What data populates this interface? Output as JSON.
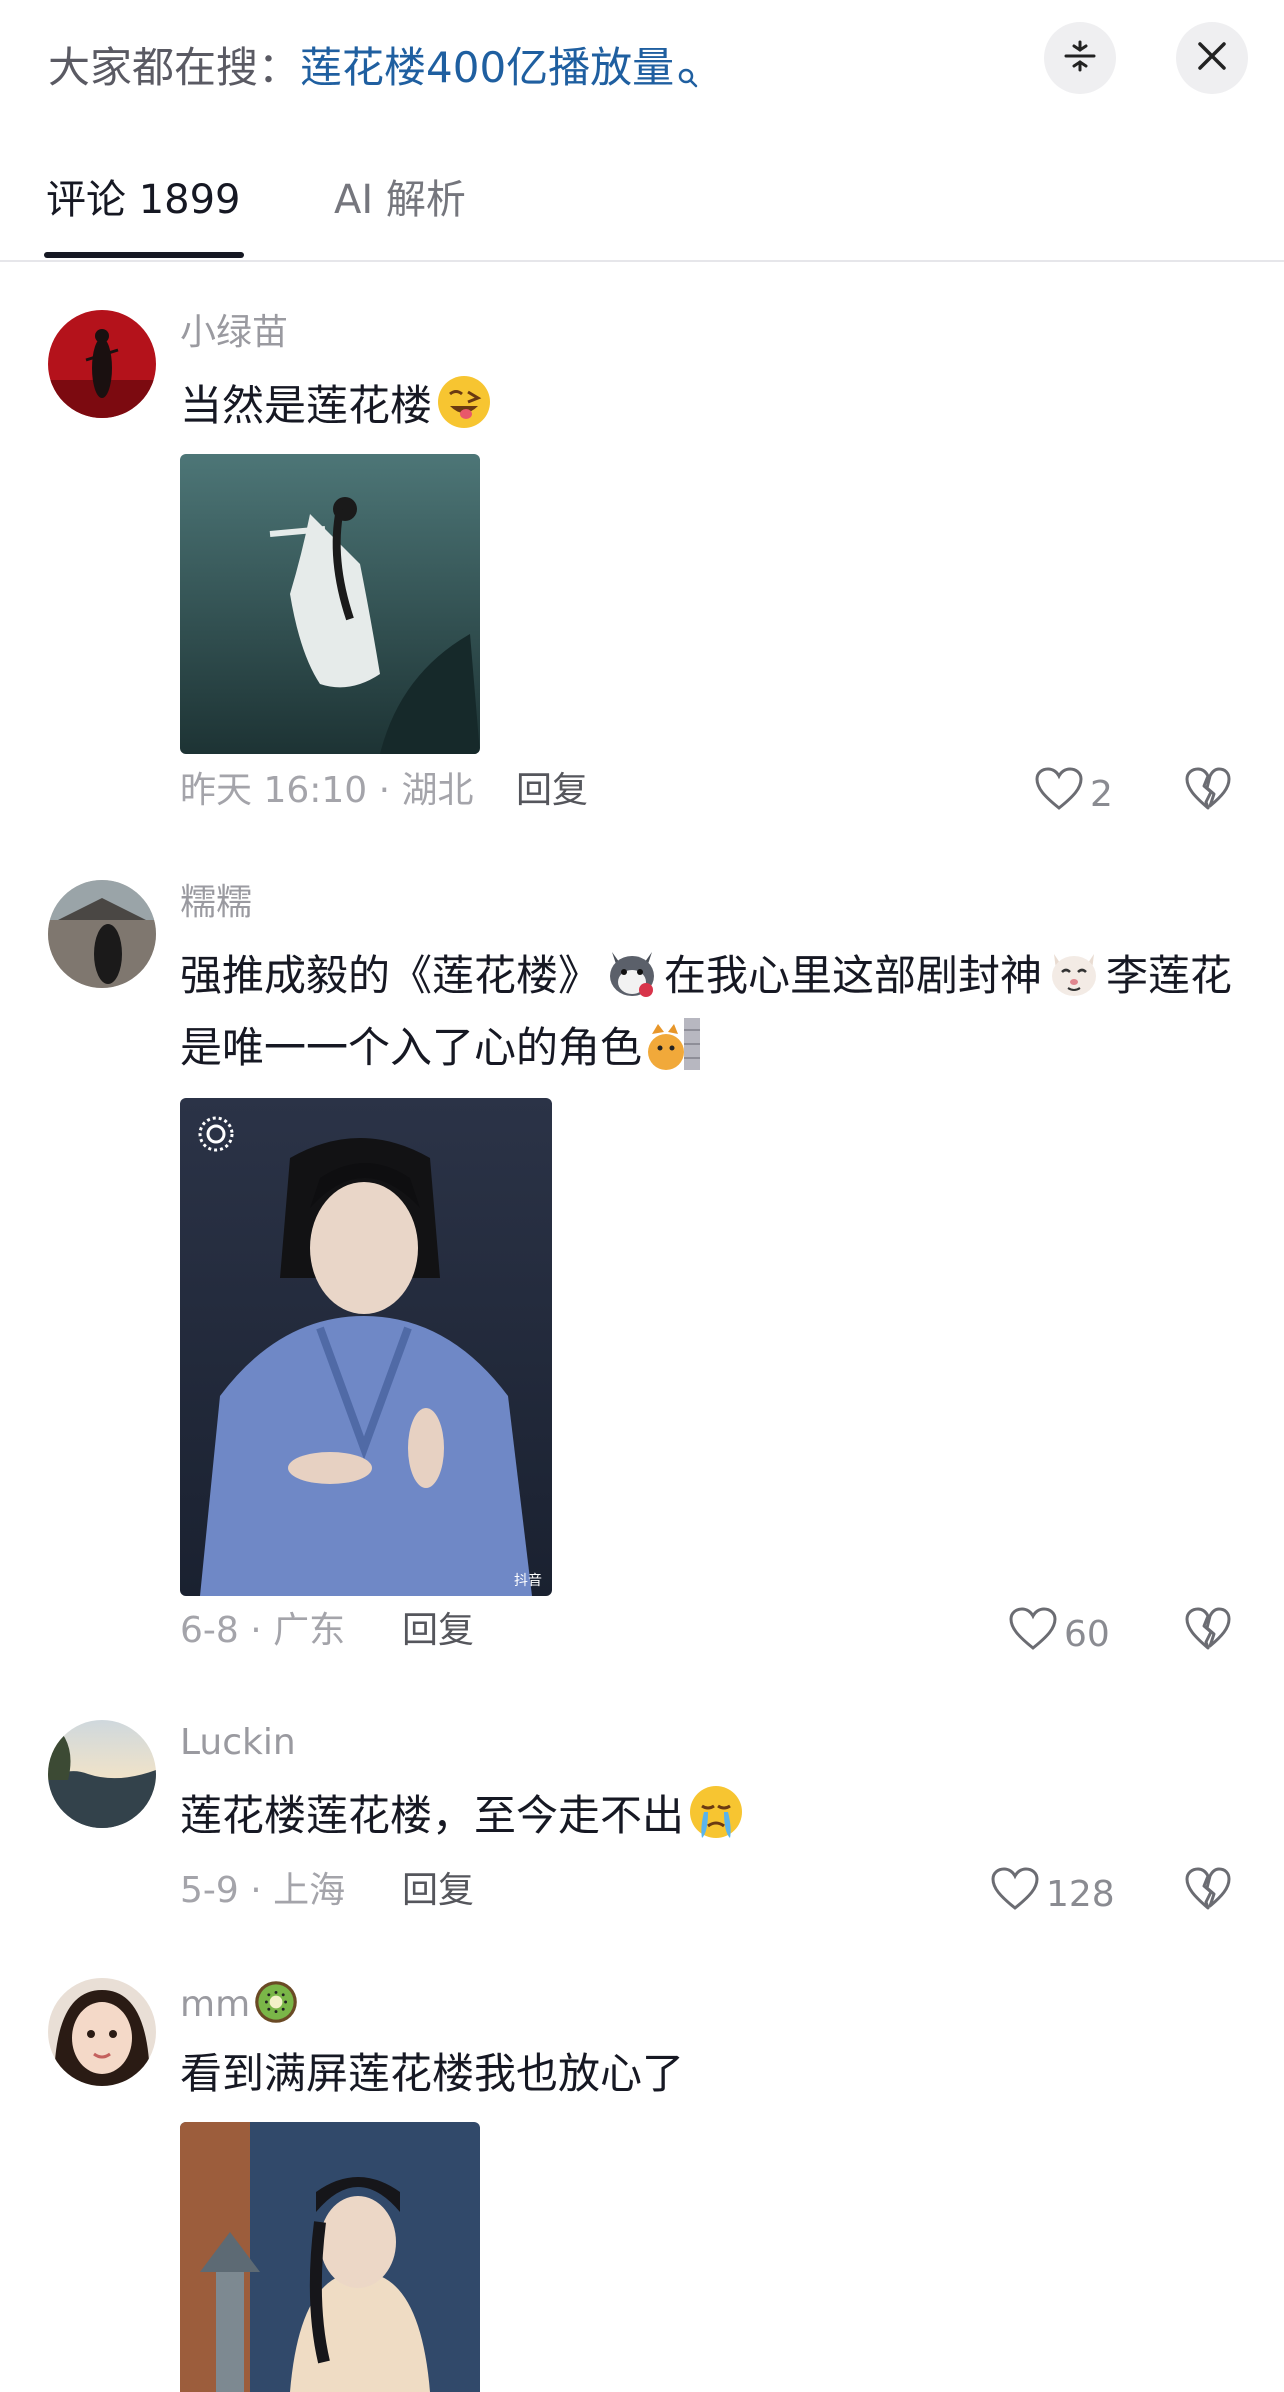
{
  "header": {
    "search_prefix": "大家都在搜：",
    "search_term": "莲花楼400亿播放量",
    "icons": [
      "search-icon",
      "collapse-icon",
      "close-icon"
    ]
  },
  "tabs": [
    {
      "label": "评论 1899",
      "active": true
    },
    {
      "label": "AI 解析",
      "active": false
    }
  ],
  "comments": [
    {
      "username": "小绿苗",
      "text": "当然是莲花楼",
      "emoji": "winking-tongue-emoji",
      "time_location": "昨天 16:10 · 湖北",
      "reply_label": "回复",
      "likes": "2"
    },
    {
      "username": "糯糯",
      "text_part1": "强推成毅的《莲花楼》",
      "text_part2": "在我心里这部剧封神",
      "text_part3": "李莲花是唯一一个入了心的角色",
      "emojis": [
        "husky-rose-emoji",
        "cat-face-emoji",
        "peeking-cat-emoji"
      ],
      "time_location": "6-8 · 广东",
      "reply_label": "回复",
      "likes": "60",
      "image_badge": "抖音"
    },
    {
      "username": "Luckin",
      "text": "莲花楼莲花楼，至今走不出",
      "emoji": "crying-face-emoji",
      "time_location": "5-9 · 上海",
      "reply_label": "回复",
      "likes": "128"
    },
    {
      "username": "mm",
      "username_emoji": "kiwi-emoji",
      "text": "看到满屏莲花楼我也放心了"
    }
  ],
  "colors": {
    "search_term": "#1f5fa0",
    "text_primary": "#161823",
    "text_secondary": "#a4a4aa"
  }
}
